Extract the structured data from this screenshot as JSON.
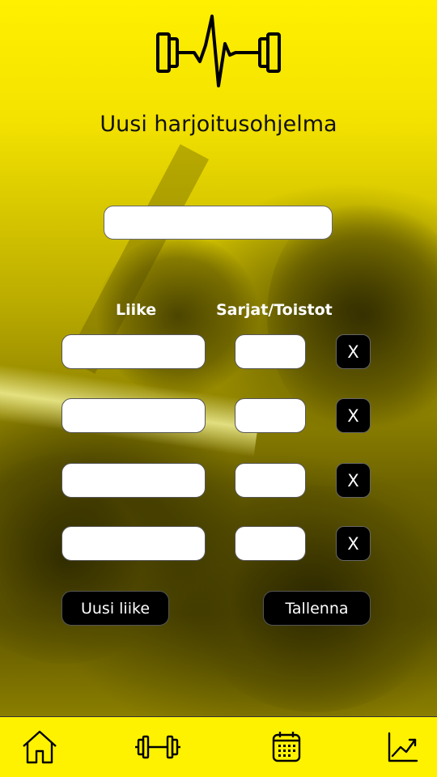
{
  "header": {
    "logo_icon": "dumbbell-heartbeat-icon",
    "title": "Uusi harjoitusohjelma"
  },
  "program_name": {
    "value": "",
    "placeholder": ""
  },
  "columns": {
    "move": "Liike",
    "sets_reps": "Sarjat/Toistot"
  },
  "rows": [
    {
      "move": "",
      "sets_reps": "",
      "remove_label": "X"
    },
    {
      "move": "",
      "sets_reps": "",
      "remove_label": "X"
    },
    {
      "move": "",
      "sets_reps": "",
      "remove_label": "X"
    },
    {
      "move": "",
      "sets_reps": "",
      "remove_label": "X"
    }
  ],
  "actions": {
    "new_move": "Uusi liike",
    "save": "Tallenna"
  },
  "nav": {
    "items": [
      {
        "icon": "home-icon"
      },
      {
        "icon": "dumbbell-icon"
      },
      {
        "icon": "calendar-icon"
      },
      {
        "icon": "chart-icon"
      }
    ]
  },
  "colors": {
    "accent": "#fff200",
    "button": "#000000",
    "text_light": "#ffffff"
  }
}
